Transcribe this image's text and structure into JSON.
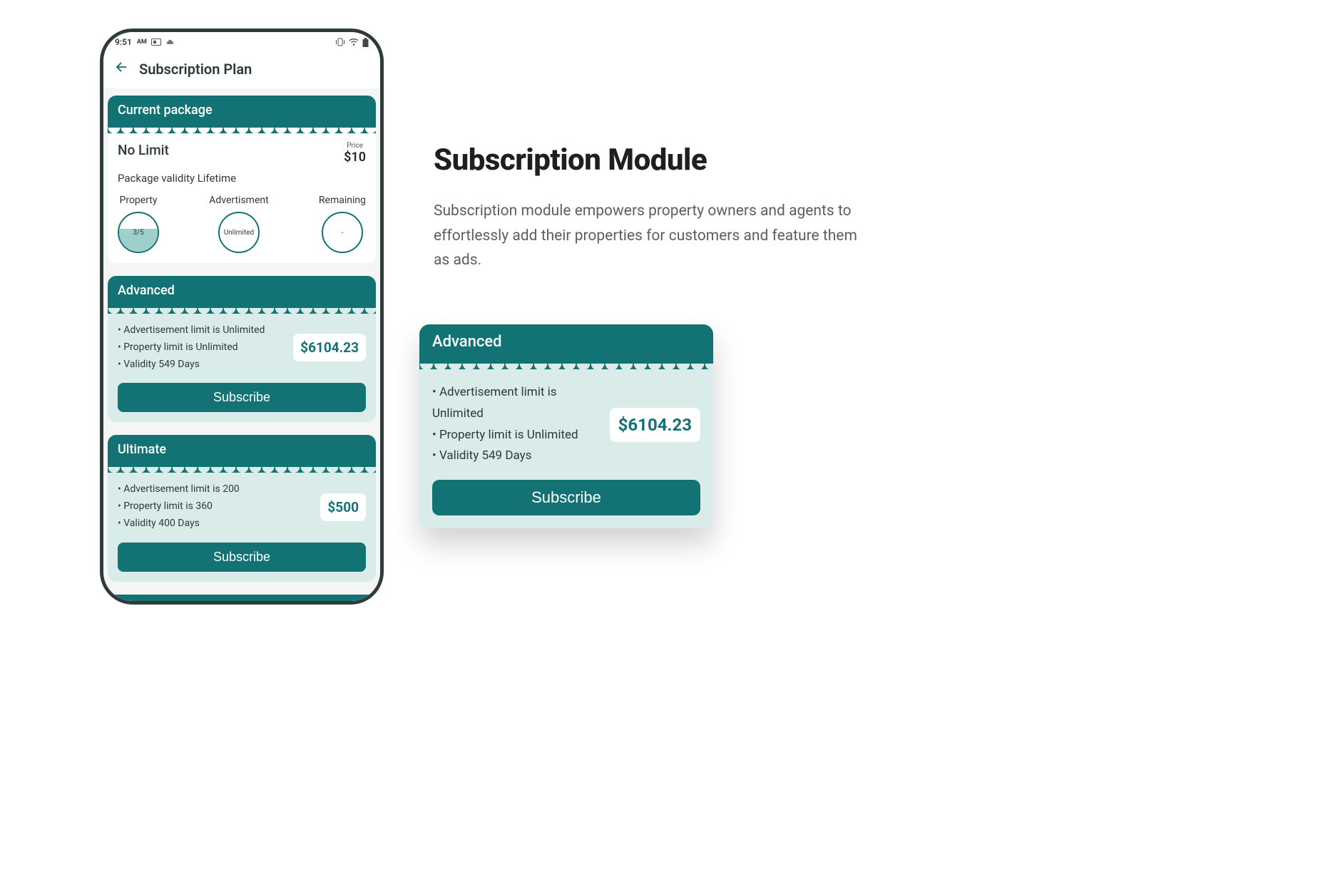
{
  "status_bar": {
    "time": "9:51",
    "ampm": "AM"
  },
  "header": {
    "title": "Subscription Plan"
  },
  "current_package": {
    "section_title": "Current package",
    "name": "No Limit",
    "price_label": "Price",
    "price": "$10",
    "validity": "Package validity Lifetime",
    "stats": {
      "property": {
        "label": "Property",
        "value": "3/5"
      },
      "advertisement": {
        "label": "Advertisment",
        "value": "Unlimited"
      },
      "remaining": {
        "label": "Remaining",
        "value": "-"
      }
    }
  },
  "plans": [
    {
      "title": "Advanced",
      "bullets": [
        "Advertisement limit is Unlimited",
        "Property limit  is Unlimited",
        "Validity 549 Days"
      ],
      "price": "$6104.23",
      "cta": "Subscribe"
    },
    {
      "title": "Ultimate",
      "bullets": [
        "Advertisement limit is 200",
        "Property limit  is 360",
        "Validity 400 Days"
      ],
      "price": "$500",
      "cta": "Subscribe"
    }
  ],
  "marketing": {
    "heading": "Subscription Module",
    "description": "Subscription module empowers property owners and agents to effortlessly add their properties for customers and feature them as ads."
  },
  "float_card": {
    "title": "Advanced",
    "bullets": [
      "Advertisement limit is Unlimited",
      "Property limit  is Unlimited",
      "Validity 549 Days"
    ],
    "price": "$6104.23",
    "cta": "Subscribe"
  }
}
